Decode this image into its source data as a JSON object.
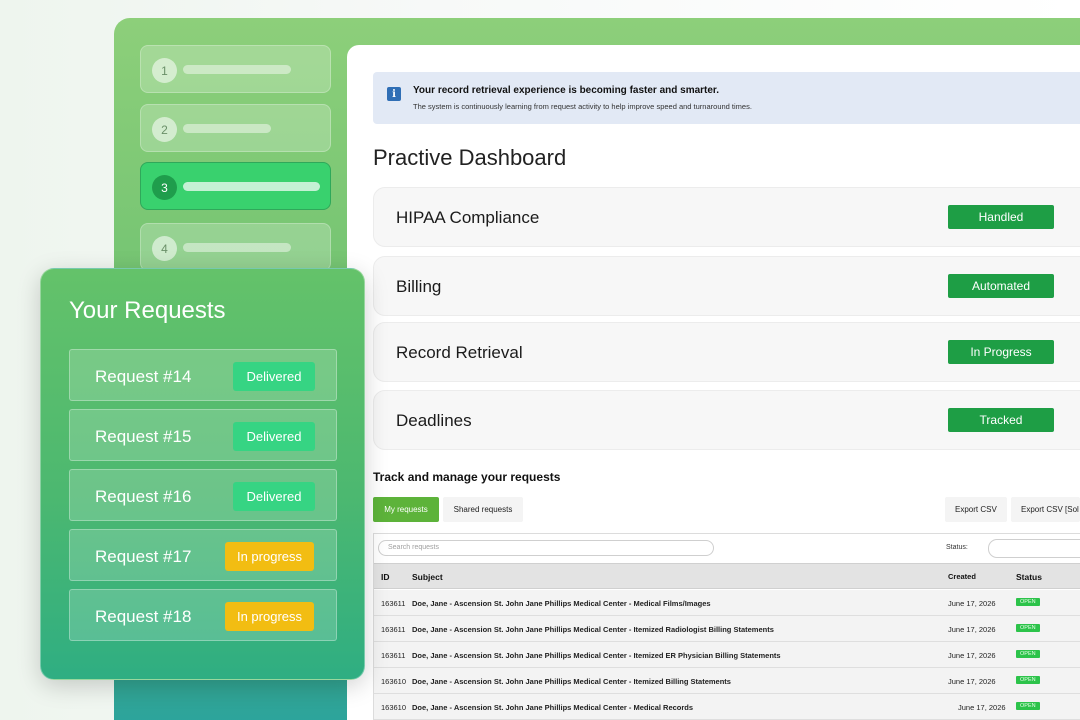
{
  "steps": [
    {
      "num": "1",
      "active": false
    },
    {
      "num": "2",
      "active": false
    },
    {
      "num": "3",
      "active": true
    },
    {
      "num": "4",
      "active": false
    }
  ],
  "notice": {
    "icon": "info-icon",
    "title": "Your record retrieval experience is becoming faster and smarter.",
    "subtitle": "The system is continuously learning from request activity to help improve speed and turnaround times."
  },
  "dashboard_title": "Practive Dashboard",
  "features": [
    {
      "label": "HIPAA Compliance",
      "status": "Handled"
    },
    {
      "label": "Billing",
      "status": "Automated"
    },
    {
      "label": "Record Retrieval",
      "status": "In Progress"
    },
    {
      "label": "Deadlines",
      "status": "Tracked"
    }
  ],
  "tracking": {
    "title": "Track and manage your requests",
    "tabs": {
      "my": "My requests",
      "shared": "Shared requests"
    },
    "export_csv": "Export CSV",
    "export_csv_sol": "Export CSV [Sol",
    "search_placeholder": "Search requests",
    "status_label": "Status:",
    "columns": {
      "id": "ID",
      "subject": "Subject",
      "created": "Created",
      "status": "Status"
    },
    "rows": [
      {
        "id": "163611",
        "subject": "Doe, Jane - Ascension St. John Jane Phillips Medical Center - Medical Films/Images",
        "created": "June 17, 2026",
        "status": "OPEN"
      },
      {
        "id": "163611",
        "subject": "Doe, Jane - Ascension St. John Jane Phillips Medical Center - Itemized Radiologist Billing Statements",
        "created": "June 17, 2026",
        "status": "OPEN"
      },
      {
        "id": "163611",
        "subject": "Doe, Jane - Ascension St. John Jane Phillips Medical Center - Itemized ER Physician Billing Statements",
        "created": "June 17, 2026",
        "status": "OPEN"
      },
      {
        "id": "163610",
        "subject": "Doe, Jane - Ascension St. John Jane Phillips Medical Center - Itemized Billing Statements",
        "created": "June 17, 2026",
        "status": "OPEN"
      },
      {
        "id": "163610",
        "subject": "Doe, Jane - Ascension St. John Jane Phillips Medical Center - Medical Records",
        "created": "June 17, 2026",
        "status": "OPEN"
      }
    ]
  },
  "requests": {
    "title": "Your Requests",
    "items": [
      {
        "label": "Request #14",
        "status": "Delivered",
        "kind": "delivered"
      },
      {
        "label": "Request #15",
        "status": "Delivered",
        "kind": "delivered"
      },
      {
        "label": "Request #16",
        "status": "Delivered",
        "kind": "delivered"
      },
      {
        "label": "Request #17",
        "status": "In progress",
        "kind": "progress"
      },
      {
        "label": "Request #18",
        "status": "In progress",
        "kind": "progress"
      }
    ]
  },
  "colors": {
    "accent_green": "#1e9e45",
    "delivered": "#36d483",
    "in_progress": "#f2bd12",
    "tab_active": "#5db33a"
  }
}
